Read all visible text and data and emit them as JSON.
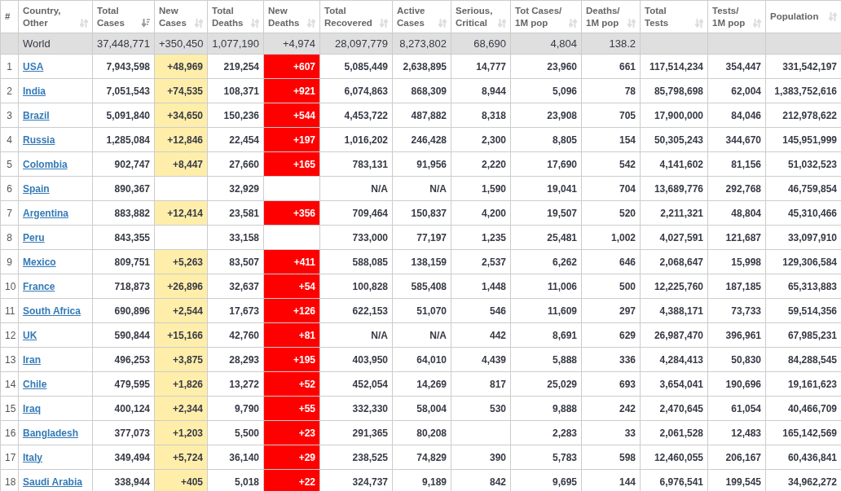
{
  "table": {
    "columns": [
      {
        "label": "#"
      },
      {
        "label": "Country,\nOther",
        "selected": false
      },
      {
        "label": "Total\nCases",
        "selected": true
      },
      {
        "label": "New\nCases",
        "selected": false
      },
      {
        "label": "Total\nDeaths",
        "selected": false
      },
      {
        "label": "New\nDeaths",
        "selected": false
      },
      {
        "label": "Total\nRecovered",
        "selected": false
      },
      {
        "label": "Active\nCases",
        "selected": false
      },
      {
        "label": "Serious,\nCritical",
        "selected": false
      },
      {
        "label": "Tot Cases/\n1M pop",
        "selected": false
      },
      {
        "label": "Deaths/\n1M pop",
        "selected": false
      },
      {
        "label": "Total\nTests",
        "selected": false
      },
      {
        "label": "Tests/\n1M pop",
        "selected": false
      },
      {
        "label": "Population",
        "selected": false
      }
    ],
    "world_row": {
      "country": "World",
      "total_cases": "37,448,771",
      "new_cases": "+350,450",
      "total_deaths": "1,077,190",
      "new_deaths": "+4,974",
      "total_recovered": "28,097,779",
      "active_cases": "8,273,802",
      "serious_critical": "68,690",
      "cases_per_1m": "4,804",
      "deaths_per_1m": "138.2"
    },
    "rows": [
      {
        "rank": "1",
        "country": "USA",
        "total_cases": "7,943,598",
        "new_cases": "+48,969",
        "total_deaths": "219,254",
        "new_deaths": "+607",
        "total_recovered": "5,085,449",
        "active_cases": "2,638,895",
        "serious_critical": "14,777",
        "cases_per_1m": "23,960",
        "deaths_per_1m": "661",
        "total_tests": "117,514,234",
        "tests_per_1m": "354,447",
        "population": "331,542,197"
      },
      {
        "rank": "2",
        "country": "India",
        "total_cases": "7,051,543",
        "new_cases": "+74,535",
        "total_deaths": "108,371",
        "new_deaths": "+921",
        "total_recovered": "6,074,863",
        "active_cases": "868,309",
        "serious_critical": "8,944",
        "cases_per_1m": "5,096",
        "deaths_per_1m": "78",
        "total_tests": "85,798,698",
        "tests_per_1m": "62,004",
        "population": "1,383,752,616"
      },
      {
        "rank": "3",
        "country": "Brazil",
        "total_cases": "5,091,840",
        "new_cases": "+34,650",
        "total_deaths": "150,236",
        "new_deaths": "+544",
        "total_recovered": "4,453,722",
        "active_cases": "487,882",
        "serious_critical": "8,318",
        "cases_per_1m": "23,908",
        "deaths_per_1m": "705",
        "total_tests": "17,900,000",
        "tests_per_1m": "84,046",
        "population": "212,978,622"
      },
      {
        "rank": "4",
        "country": "Russia",
        "total_cases": "1,285,084",
        "new_cases": "+12,846",
        "total_deaths": "22,454",
        "new_deaths": "+197",
        "total_recovered": "1,016,202",
        "active_cases": "246,428",
        "serious_critical": "2,300",
        "cases_per_1m": "8,805",
        "deaths_per_1m": "154",
        "total_tests": "50,305,243",
        "tests_per_1m": "344,670",
        "population": "145,951,999"
      },
      {
        "rank": "5",
        "country": "Colombia",
        "total_cases": "902,747",
        "new_cases": "+8,447",
        "total_deaths": "27,660",
        "new_deaths": "+165",
        "total_recovered": "783,131",
        "active_cases": "91,956",
        "serious_critical": "2,220",
        "cases_per_1m": "17,690",
        "deaths_per_1m": "542",
        "total_tests": "4,141,602",
        "tests_per_1m": "81,156",
        "population": "51,032,523"
      },
      {
        "rank": "6",
        "country": "Spain",
        "total_cases": "890,367",
        "total_deaths": "32,929",
        "total_recovered": "N/A",
        "active_cases": "N/A",
        "serious_critical": "1,590",
        "cases_per_1m": "19,041",
        "deaths_per_1m": "704",
        "total_tests": "13,689,776",
        "tests_per_1m": "292,768",
        "population": "46,759,854"
      },
      {
        "rank": "7",
        "country": "Argentina",
        "total_cases": "883,882",
        "new_cases": "+12,414",
        "total_deaths": "23,581",
        "new_deaths": "+356",
        "total_recovered": "709,464",
        "active_cases": "150,837",
        "serious_critical": "4,200",
        "cases_per_1m": "19,507",
        "deaths_per_1m": "520",
        "total_tests": "2,211,321",
        "tests_per_1m": "48,804",
        "population": "45,310,466"
      },
      {
        "rank": "8",
        "country": "Peru",
        "total_cases": "843,355",
        "total_deaths": "33,158",
        "total_recovered": "733,000",
        "active_cases": "77,197",
        "serious_critical": "1,235",
        "cases_per_1m": "25,481",
        "deaths_per_1m": "1,002",
        "total_tests": "4,027,591",
        "tests_per_1m": "121,687",
        "population": "33,097,910"
      },
      {
        "rank": "9",
        "country": "Mexico",
        "total_cases": "809,751",
        "new_cases": "+5,263",
        "total_deaths": "83,507",
        "new_deaths": "+411",
        "total_recovered": "588,085",
        "active_cases": "138,159",
        "serious_critical": "2,537",
        "cases_per_1m": "6,262",
        "deaths_per_1m": "646",
        "total_tests": "2,068,647",
        "tests_per_1m": "15,998",
        "population": "129,306,584"
      },
      {
        "rank": "10",
        "country": "France",
        "total_cases": "718,873",
        "new_cases": "+26,896",
        "total_deaths": "32,637",
        "new_deaths": "+54",
        "total_recovered": "100,828",
        "active_cases": "585,408",
        "serious_critical": "1,448",
        "cases_per_1m": "11,006",
        "deaths_per_1m": "500",
        "total_tests": "12,225,760",
        "tests_per_1m": "187,185",
        "population": "65,313,883"
      },
      {
        "rank": "11",
        "country": "South Africa",
        "total_cases": "690,896",
        "new_cases": "+2,544",
        "total_deaths": "17,673",
        "new_deaths": "+126",
        "total_recovered": "622,153",
        "active_cases": "51,070",
        "serious_critical": "546",
        "cases_per_1m": "11,609",
        "deaths_per_1m": "297",
        "total_tests": "4,388,171",
        "tests_per_1m": "73,733",
        "population": "59,514,356"
      },
      {
        "rank": "12",
        "country": "UK",
        "total_cases": "590,844",
        "new_cases": "+15,166",
        "total_deaths": "42,760",
        "new_deaths": "+81",
        "total_recovered": "N/A",
        "active_cases": "N/A",
        "serious_critical": "442",
        "cases_per_1m": "8,691",
        "deaths_per_1m": "629",
        "total_tests": "26,987,470",
        "tests_per_1m": "396,961",
        "population": "67,985,231"
      },
      {
        "rank": "13",
        "country": "Iran",
        "total_cases": "496,253",
        "new_cases": "+3,875",
        "total_deaths": "28,293",
        "new_deaths": "+195",
        "total_recovered": "403,950",
        "active_cases": "64,010",
        "serious_critical": "4,439",
        "cases_per_1m": "5,888",
        "deaths_per_1m": "336",
        "total_tests": "4,284,413",
        "tests_per_1m": "50,830",
        "population": "84,288,545"
      },
      {
        "rank": "14",
        "country": "Chile",
        "total_cases": "479,595",
        "new_cases": "+1,826",
        "total_deaths": "13,272",
        "new_deaths": "+52",
        "total_recovered": "452,054",
        "active_cases": "14,269",
        "serious_critical": "817",
        "cases_per_1m": "25,029",
        "deaths_per_1m": "693",
        "total_tests": "3,654,041",
        "tests_per_1m": "190,696",
        "population": "19,161,623"
      },
      {
        "rank": "15",
        "country": "Iraq",
        "total_cases": "400,124",
        "new_cases": "+2,344",
        "total_deaths": "9,790",
        "new_deaths": "+55",
        "total_recovered": "332,330",
        "active_cases": "58,004",
        "serious_critical": "530",
        "cases_per_1m": "9,888",
        "deaths_per_1m": "242",
        "total_tests": "2,470,645",
        "tests_per_1m": "61,054",
        "population": "40,466,709"
      },
      {
        "rank": "16",
        "country": "Bangladesh",
        "total_cases": "377,073",
        "new_cases": "+1,203",
        "total_deaths": "5,500",
        "new_deaths": "+23",
        "total_recovered": "291,365",
        "active_cases": "80,208",
        "cases_per_1m": "2,283",
        "deaths_per_1m": "33",
        "total_tests": "2,061,528",
        "tests_per_1m": "12,483",
        "population": "165,142,569"
      },
      {
        "rank": "17",
        "country": "Italy",
        "total_cases": "349,494",
        "new_cases": "+5,724",
        "total_deaths": "36,140",
        "new_deaths": "+29",
        "total_recovered": "238,525",
        "active_cases": "74,829",
        "serious_critical": "390",
        "cases_per_1m": "5,783",
        "deaths_per_1m": "598",
        "total_tests": "12,460,055",
        "tests_per_1m": "206,167",
        "population": "60,436,841"
      },
      {
        "rank": "18",
        "country": "Saudi Arabia",
        "total_cases": "338,944",
        "new_cases": "+405",
        "total_deaths": "5,018",
        "new_deaths": "+22",
        "total_recovered": "324,737",
        "active_cases": "9,189",
        "serious_critical": "842",
        "cases_per_1m": "9,695",
        "deaths_per_1m": "144",
        "total_tests": "6,976,541",
        "tests_per_1m": "199,545",
        "population": "34,962,272"
      }
    ]
  }
}
